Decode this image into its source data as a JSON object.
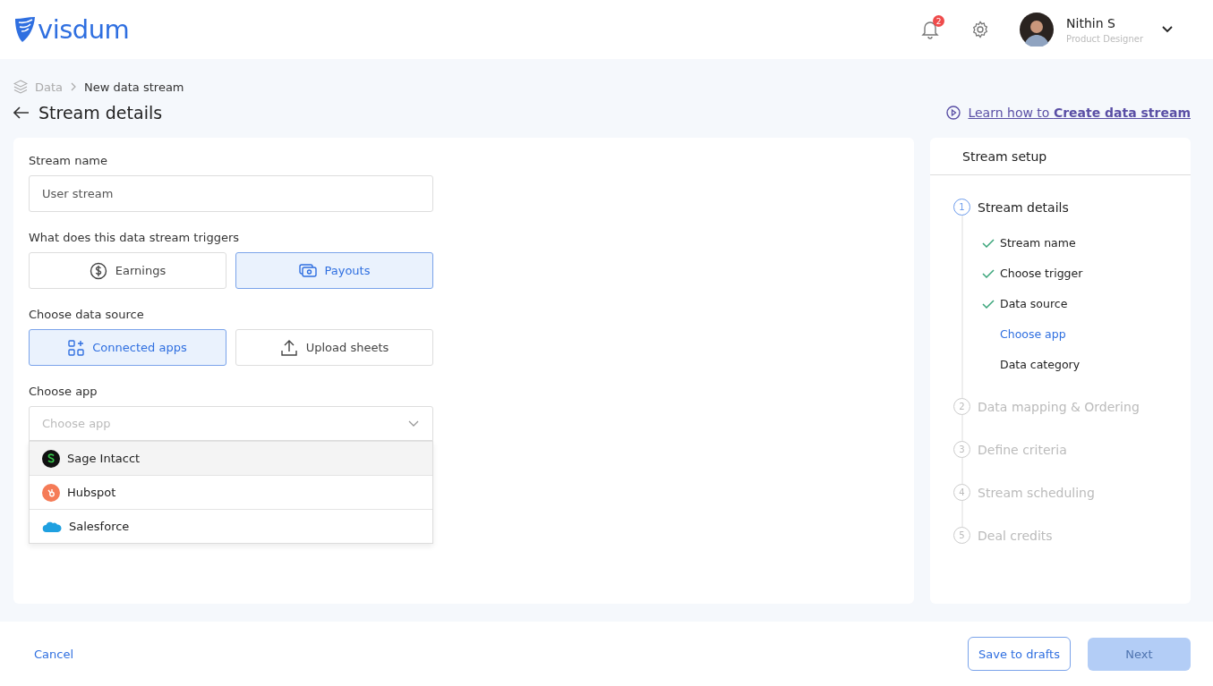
{
  "header": {
    "logo": "visdum",
    "notifications": "2",
    "user": {
      "name": "Nithin S",
      "role": "Product Designer"
    }
  },
  "breadcrumb": [
    {
      "label": "Data",
      "current": false
    },
    {
      "label": "New data stream",
      "current": true
    }
  ],
  "page_title": "Stream details",
  "help_link": {
    "prefix": "Learn how to",
    "emphasis": "Create data stream"
  },
  "form": {
    "stream_name": {
      "label": "Stream name",
      "value": "User stream"
    },
    "triggers": {
      "label": "What does this data stream triggers",
      "options": [
        {
          "label": "Earnings",
          "selected": false
        },
        {
          "label": "Payouts",
          "selected": true
        }
      ]
    },
    "sources": {
      "label": "Choose data source",
      "options": [
        {
          "label": "Connected apps",
          "selected": true
        },
        {
          "label": "Upload sheets",
          "selected": false
        }
      ]
    },
    "app": {
      "label": "Choose app",
      "placeholder": "Choose app",
      "expanded": true,
      "options": [
        {
          "label": "Sage Intacct",
          "highlighted": true
        },
        {
          "label": "Hubspot",
          "highlighted": false
        },
        {
          "label": "Salesforce",
          "highlighted": false
        }
      ]
    }
  },
  "setup": {
    "title": "Stream setup",
    "steps": [
      {
        "number": "1",
        "label": "Stream details",
        "active": true,
        "children": [
          {
            "label": "Stream name",
            "done": true,
            "selected": false
          },
          {
            "label": "Choose trigger",
            "done": true,
            "selected": false
          },
          {
            "label": "Data source",
            "done": true,
            "selected": false
          },
          {
            "label": "Choose app",
            "done": false,
            "selected": true
          },
          {
            "label": "Data category",
            "done": false,
            "selected": false
          }
        ]
      },
      {
        "number": "2",
        "label": "Data mapping & Ordering",
        "active": false
      },
      {
        "number": "3",
        "label": "Define criteria",
        "active": false
      },
      {
        "number": "4",
        "label": "Stream scheduling",
        "active": false
      },
      {
        "number": "5",
        "label": "Deal credits",
        "active": false
      }
    ]
  },
  "footer": {
    "cancel": "Cancel",
    "save": "Save to drafts",
    "next": {
      "label": "Next",
      "disabled": true
    }
  }
}
